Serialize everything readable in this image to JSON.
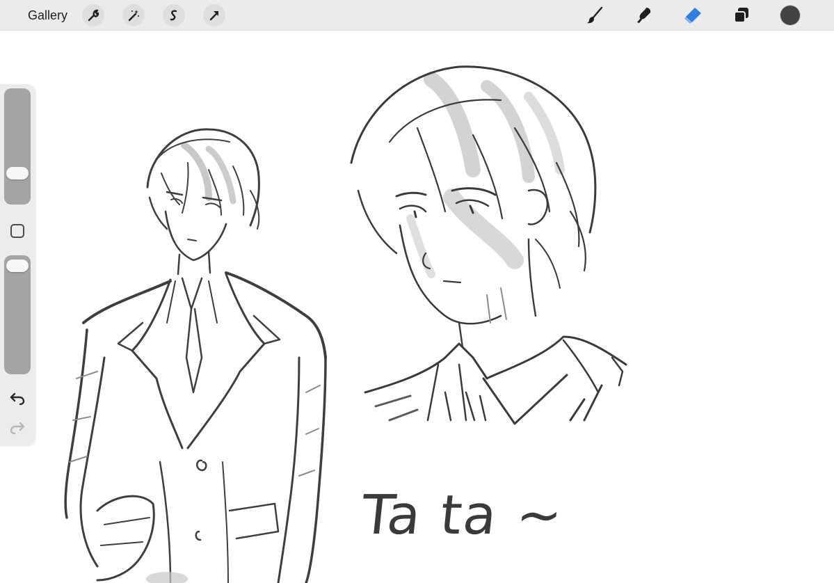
{
  "toolbar": {
    "gallery_label": "Gallery",
    "left_tools": [
      "wrench-icon",
      "magic-wand-icon",
      "selection-icon",
      "transform-arrow-icon"
    ],
    "right_tools": [
      "brush-icon",
      "smudge-icon",
      "eraser-icon",
      "layers-icon",
      "color-swatch"
    ],
    "active_tool": "eraser",
    "accent_color": "#2f7fe0",
    "current_color": "#434343"
  },
  "sidebar": {
    "brush_size_level": 0.28,
    "opacity_level": 0.05,
    "modifier_button": "square-modifier",
    "undo_icon": "undo-icon",
    "redo_icon": "redo-icon",
    "redo_enabled": false
  },
  "canvas": {
    "handwritten_text": "Ta ta ~"
  }
}
